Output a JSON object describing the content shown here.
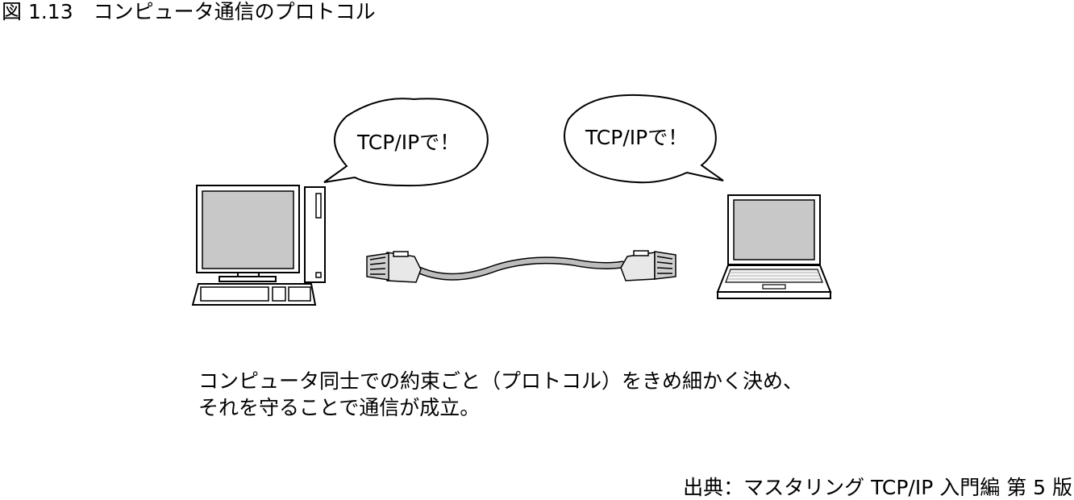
{
  "figure": {
    "title": "図 1.13　コンピュータ通信のプロトコル"
  },
  "diagram": {
    "bubble_left": "TCP/IPで！",
    "bubble_right": "TCP/IPで！"
  },
  "caption": {
    "line1": "コンピュータ同士での約束ごと（プロトコル）をきめ細かく決め、",
    "line2": "それを守ることで通信が成立。"
  },
  "source": "出典：マスタリング TCP/IP 入門編 第 5 版"
}
